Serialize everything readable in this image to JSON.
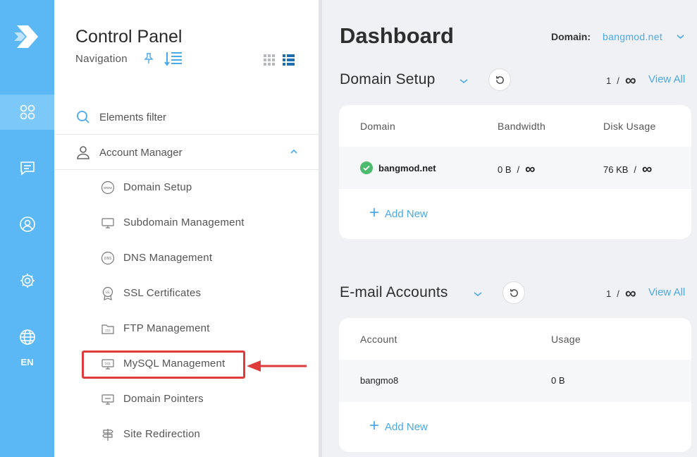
{
  "rail": {
    "lang": "EN",
    "icons": [
      "logo-icon",
      "apps-icon",
      "chat-icon",
      "user-circle-icon",
      "gear-icon",
      "globe-icon"
    ]
  },
  "nav": {
    "title": "Control Panel",
    "subtitle": "Navigation",
    "filter_placeholder": "Elements filter",
    "group_label": "Account Manager",
    "items": [
      {
        "label": "Domain Setup",
        "icon": "www-icon"
      },
      {
        "label": "Subdomain Management",
        "icon": "monitor-icon"
      },
      {
        "label": "DNS Management",
        "icon": "dns-icon"
      },
      {
        "label": "SSL Certificates",
        "icon": "ssl-icon"
      },
      {
        "label": "FTP Management",
        "icon": "folder-ftp-icon"
      },
      {
        "label": "MySQL Management",
        "icon": "sql-icon"
      },
      {
        "label": "Domain Pointers",
        "icon": "pointer-icon"
      },
      {
        "label": "Site Redirection",
        "icon": "signpost-icon"
      }
    ]
  },
  "main": {
    "title": "Dashboard",
    "domain_label": "Domain:",
    "domain_value": "bangmod.net",
    "domain_setup": {
      "title": "Domain Setup",
      "count": "1",
      "sep": "/",
      "limit": "∞",
      "view_all": "View All",
      "columns": [
        "Domain",
        "Bandwidth",
        "Disk Usage"
      ],
      "row": {
        "domain": "bangmod.net",
        "bandwidth": "0 B",
        "disk": "76 KB",
        "sep": "/",
        "limit": "∞"
      },
      "add_new": "Add New"
    },
    "email_accounts": {
      "title": "E-mail Accounts",
      "count": "1",
      "sep": "/",
      "limit": "∞",
      "view_all": "View All",
      "columns": [
        "Account",
        "Usage"
      ],
      "row": {
        "account": "bangmo8",
        "usage": "0 B"
      },
      "add_new": "Add New"
    }
  },
  "colors": {
    "rail_bg": "#5bb8f5",
    "accent": "#4aa9e8",
    "highlight": "#e03b3b",
    "success": "#4cbb6e"
  }
}
